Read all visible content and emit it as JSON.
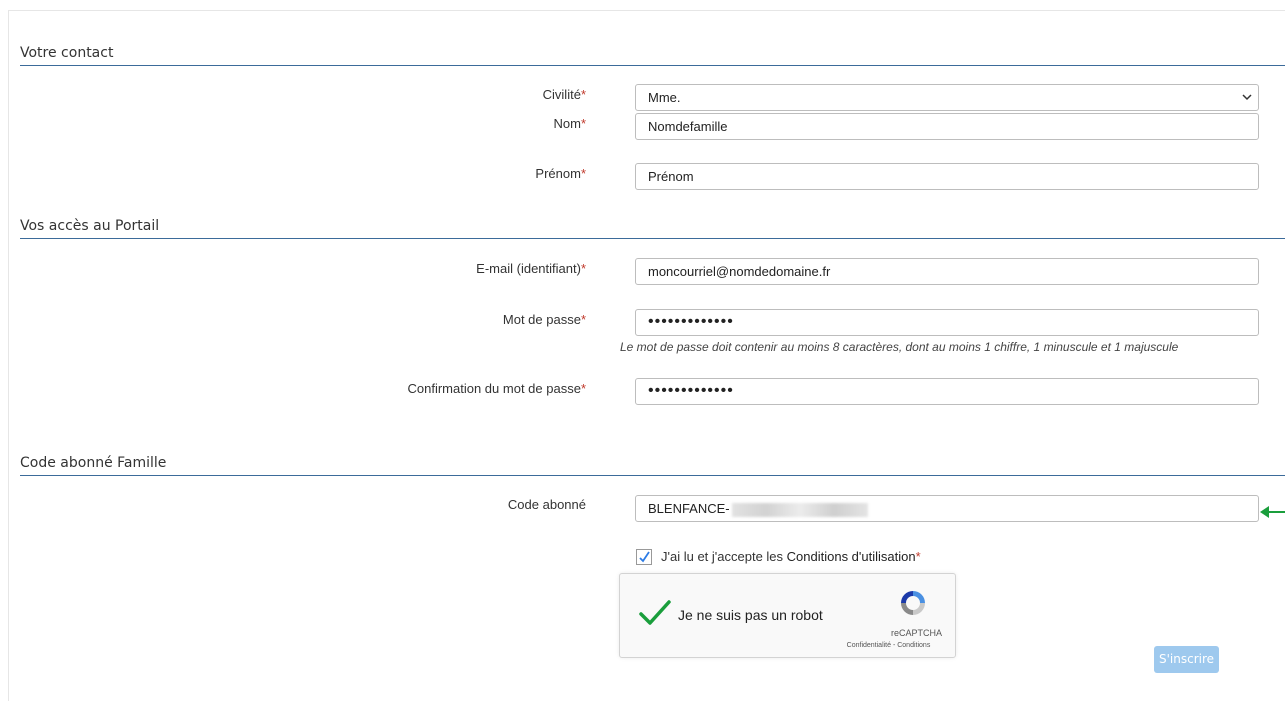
{
  "sections": {
    "contact": "Votre contact",
    "access": "Vos accès au Portail",
    "code": "Code abonné Famille"
  },
  "fields": {
    "civilite": {
      "label": "Civilité",
      "value": "Mme."
    },
    "nom": {
      "label": "Nom",
      "value": "Nomdefamille"
    },
    "prenom": {
      "label": "Prénom",
      "value": "Prénom"
    },
    "email": {
      "label": "E-mail (identifiant)",
      "value": "moncourriel@nomdedomaine.fr"
    },
    "password": {
      "label": "Mot de passe",
      "value": "•••••••••••••"
    },
    "password_help": "Le mot de passe doit contenir au moins 8 caractères, dont au moins 1 chiffre, 1 minuscule et 1 majuscule",
    "confirm": {
      "label": "Confirmation du mot de passe",
      "value": "•••••••••••••"
    },
    "code_abonne": {
      "label": "Code abonné",
      "value": "BLENFANCE-"
    }
  },
  "required_mark": "*",
  "terms": {
    "prefix": "J'ai lu et j'accepte les ",
    "link": "Conditions d'utilisation"
  },
  "captcha": {
    "label": "Je ne suis pas un robot",
    "brand": "reCAPTCHA",
    "links": "Confidentialité - Conditions"
  },
  "submit_label": "S'inscrire",
  "colors": {
    "accent": "#3b6b9a",
    "required": "#c0392b",
    "button": "#9ec9ee",
    "arrow": "#1a9e3c",
    "check": "#1a9e3c"
  }
}
